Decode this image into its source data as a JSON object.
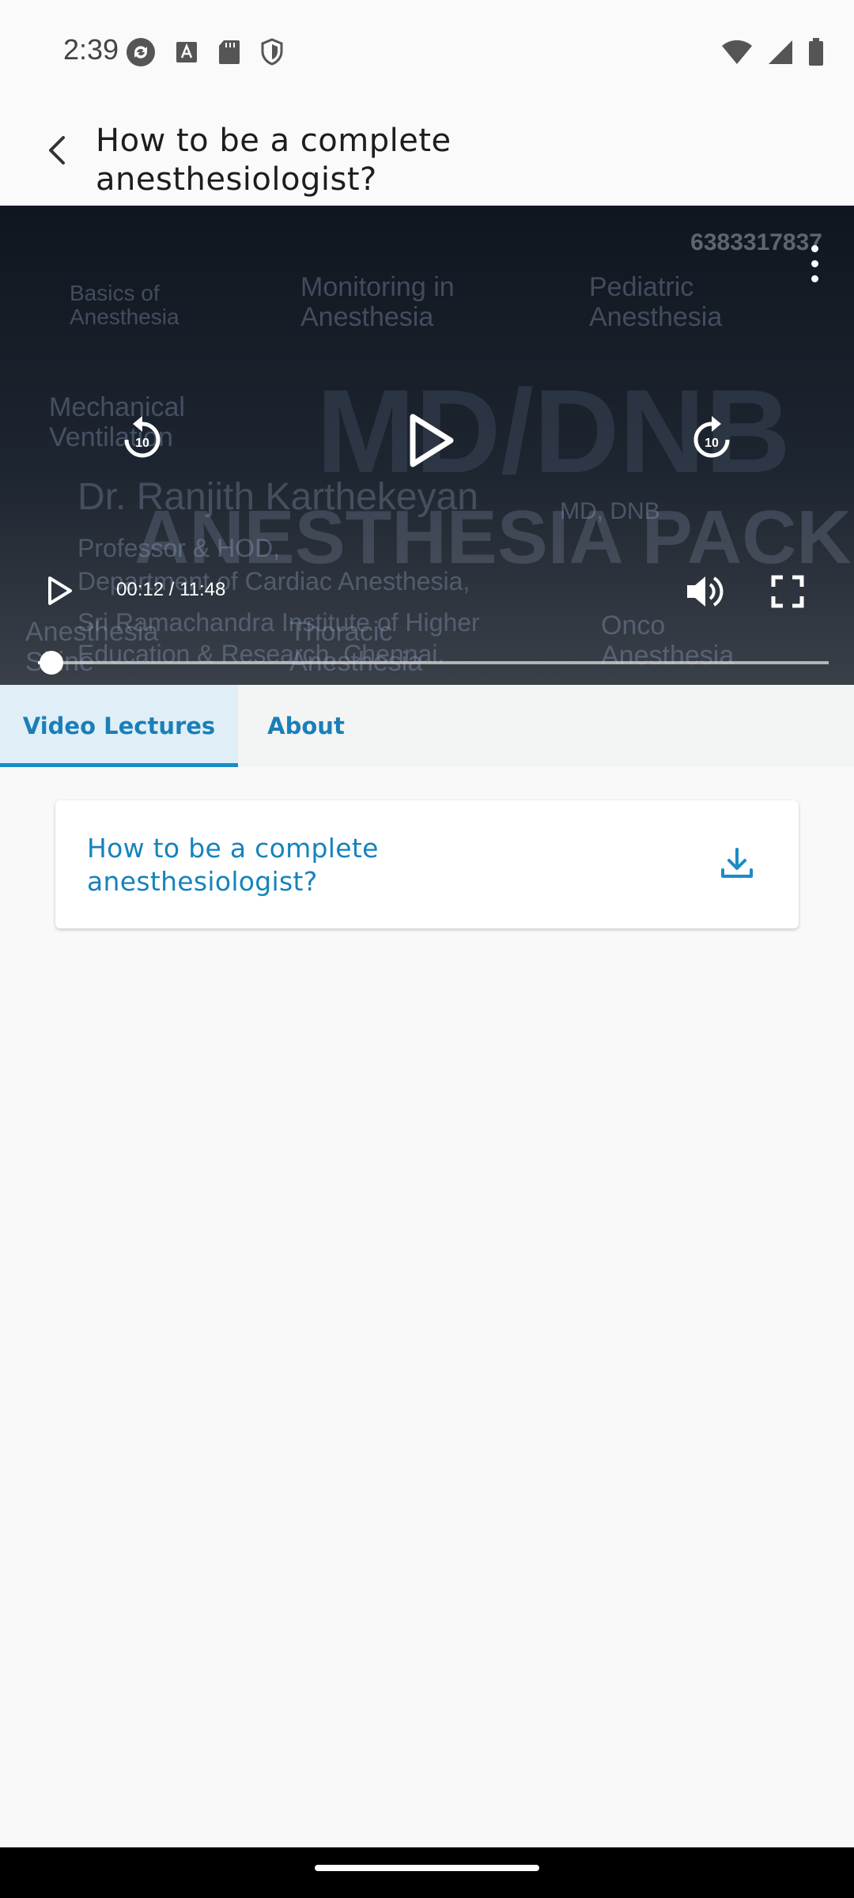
{
  "status_bar": {
    "time": "2:39",
    "left_icons": [
      "sync-icon",
      "text-a-icon",
      "sd-card-icon",
      "shield-icon"
    ],
    "right_icons": [
      "wifi-icon",
      "signal-icon",
      "battery-icon"
    ]
  },
  "app_bar": {
    "title": "How to be a complete anesthesiologist?",
    "back_icon": "back-arrow-icon"
  },
  "video": {
    "watermark": "6383317837",
    "background_text": {
      "big_title": "MD/DNB",
      "pack_title": "ANESTHESIA PACK",
      "topics": [
        "Basics of Anesthesia",
        "Monitoring in Anesthesia",
        "Pediatric Anesthesia",
        "Mechanical Ventilation",
        "Anesthesia Shine",
        "Thoracic Anesthesia",
        "Onco Anesthesia"
      ],
      "presenter": "Dr. Ranjith Karthekeyan",
      "presenter_degree": "MD, DNB",
      "presenter_role": "Professor & HOD,",
      "presenter_dept": "Department of Cardiac Anesthesia,",
      "presenter_inst": "Sri Ramachandra Institute of Higher",
      "presenter_inst2": "Education & Research, Chennai."
    },
    "current_time": "00:12",
    "duration": "11:48",
    "time_display": "00:12 / 11:48",
    "progress_fraction": 0.017,
    "rewind_seconds": "10",
    "forward_seconds": "10"
  },
  "tabs": [
    {
      "label": "Video Lectures",
      "active": true
    },
    {
      "label": "About",
      "active": false
    }
  ],
  "lectures": [
    {
      "title": "How to be a complete anesthesiologist?",
      "action_icon": "download-icon"
    }
  ],
  "colors": {
    "accent": "#1a8cc8",
    "tab_active_bg": "#e0eff7",
    "page_bg": "#f9f9f9"
  }
}
